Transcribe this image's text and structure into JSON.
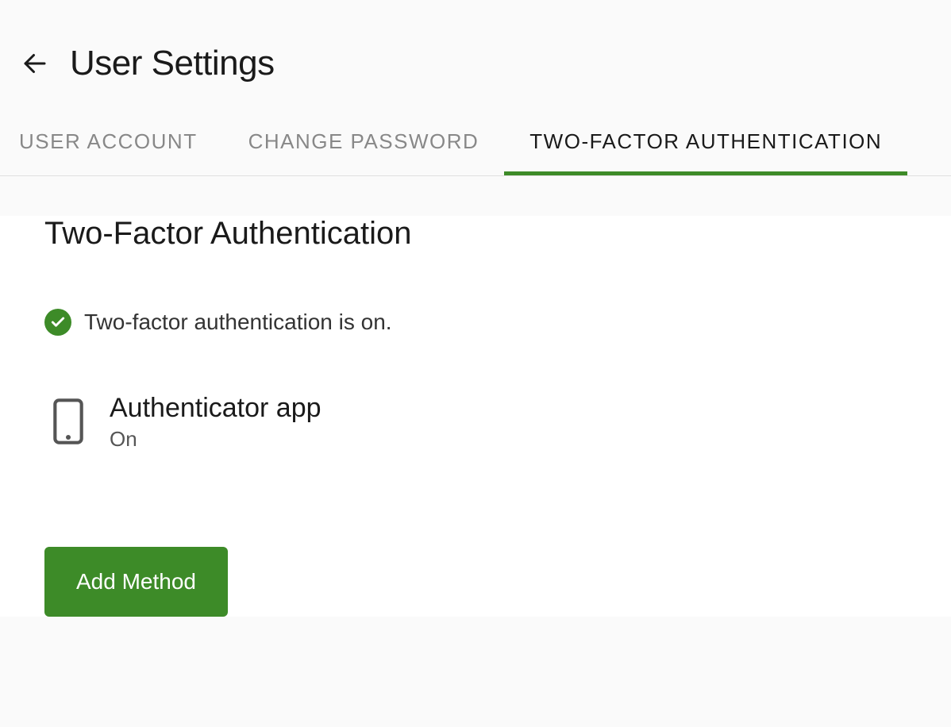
{
  "header": {
    "title": "User Settings"
  },
  "tabs": {
    "user_account": "USER ACCOUNT",
    "change_password": "CHANGE PASSWORD",
    "two_factor": "TWO-FACTOR AUTHENTICATION"
  },
  "section": {
    "heading": "Two-Factor Authentication",
    "status_text": "Two-factor authentication is on."
  },
  "method": {
    "name": "Authenticator app",
    "status": "On"
  },
  "actions": {
    "add_method": "Add Method"
  },
  "colors": {
    "accent": "#3d8b28"
  }
}
